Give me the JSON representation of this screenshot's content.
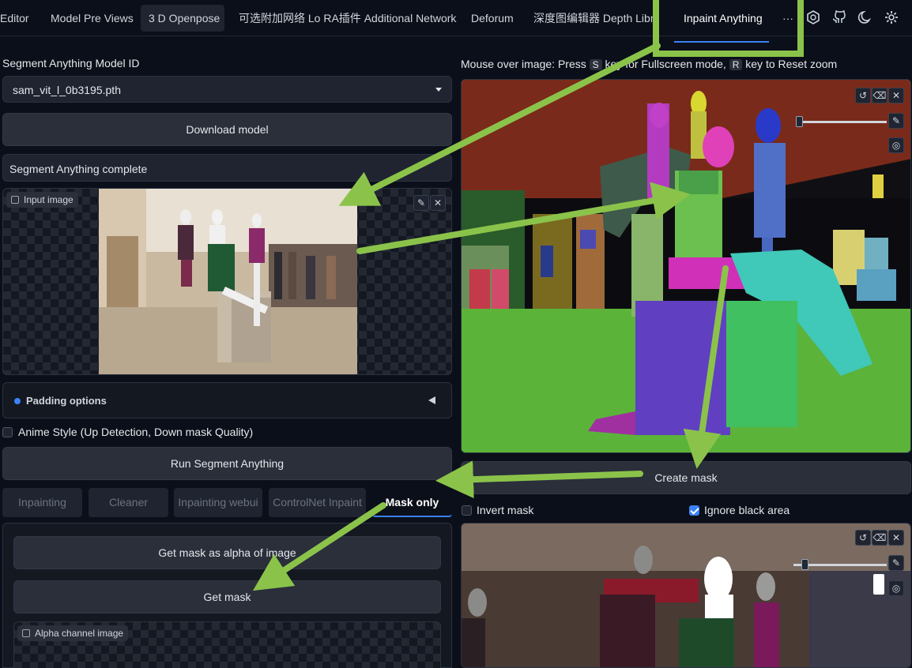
{
  "tabs": [
    {
      "label": "Editor"
    },
    {
      "label": "Model Pre Views"
    },
    {
      "label": "3 D Openpose"
    },
    {
      "label": "可选附加网络 Lo RA插件 Additional Networks"
    },
    {
      "label": "Deforum"
    },
    {
      "label": "深度图编辑器 Depth Library"
    },
    {
      "label": "Inpaint Anything"
    },
    {
      "label": "···"
    }
  ],
  "top_icons": [
    "hexagon-icon",
    "github-icon",
    "moon-icon",
    "gear-icon"
  ],
  "left": {
    "model_label": "Segment Anything Model ID",
    "model_value": "sam_vit_l_0b3195.pth",
    "download_button": "Download model",
    "status_text": "Segment Anything complete",
    "input_image_label": "Input image",
    "padding_label": "Padding options",
    "anime_label": "Anime Style (Up Detection, Down mask Quality)",
    "run_button": "Run Segment Anything",
    "subtabs": [
      "Inpainting",
      "Cleaner",
      "Inpainting webui",
      "ControlNet Inpaint",
      "Mask only"
    ],
    "alpha_button": "Get mask as alpha of image",
    "mask_button": "Get mask",
    "alpha_image_label": "Alpha channel image"
  },
  "right": {
    "hint_prefix": "Mouse over image: Press ",
    "hint_key1": "S",
    "hint_middle": " key for Fullscreen mode, ",
    "hint_key2": "R",
    "hint_suffix": " key to Reset zoom",
    "create_mask_button": "Create mask",
    "invert_mask_label": "Invert mask",
    "invert_mask_checked": false,
    "ignore_black_label": "Ignore black area",
    "ignore_black_checked": true
  },
  "colors": {
    "accent": "#3b82f6",
    "highlight_box": "#8bc34a",
    "arrow": "#8bc34a"
  }
}
